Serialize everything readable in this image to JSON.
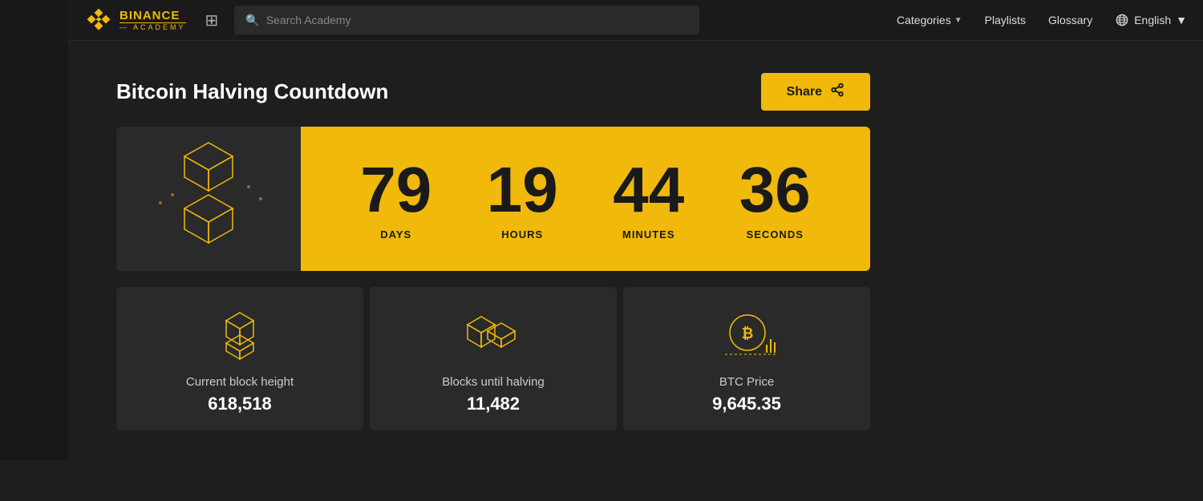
{
  "sidebar": {},
  "navbar": {
    "logo": {
      "binance": "BINANCE",
      "academy": "— ACADEMY"
    },
    "search_placeholder": "Search Academy",
    "categories_label": "Categories",
    "playlists_label": "Playlists",
    "glossary_label": "Glossary",
    "language_label": "English"
  },
  "countdown": {
    "title": "Bitcoin Halving Countdown",
    "share_label": "Share",
    "timer": {
      "days_value": "79",
      "days_label": "DAYS",
      "hours_value": "19",
      "hours_label": "HOURS",
      "minutes_value": "44",
      "minutes_label": "MINUTES",
      "seconds_value": "36",
      "seconds_label": "SECONDS"
    }
  },
  "stats": [
    {
      "label": "Current block height",
      "value": "618,518"
    },
    {
      "label": "Blocks until halving",
      "value": "11,482"
    },
    {
      "label": "BTC Price",
      "value": "9,645.35"
    }
  ],
  "colors": {
    "accent": "#f0b90b",
    "bg_dark": "#1a1a1a",
    "bg_card": "#2a2a2a"
  }
}
